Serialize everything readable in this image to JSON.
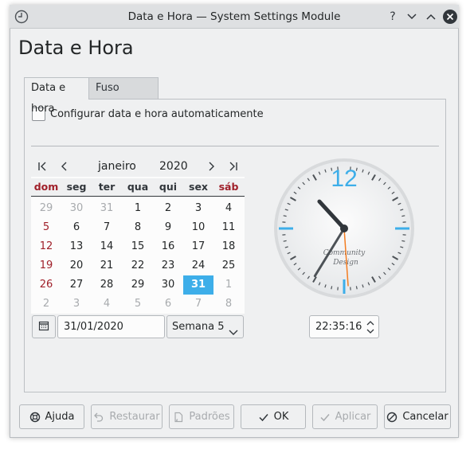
{
  "window": {
    "title": "Data e Hora — System Settings Module",
    "buttons": [
      "help",
      "minimize",
      "maximize",
      "close"
    ]
  },
  "page": {
    "title": "Data e Hora"
  },
  "tabs": [
    {
      "label": "Data e hora",
      "active": true
    },
    {
      "label": "Fuso horário",
      "active": false
    }
  ],
  "auto_config": {
    "label": "Configurar data e hora automaticamente",
    "checked": false
  },
  "calendar": {
    "month": "janeiro",
    "year": "2020",
    "weekdays": [
      "dom",
      "seg",
      "ter",
      "qua",
      "qui",
      "sex",
      "sáb"
    ],
    "weeks": [
      [
        "29",
        "30",
        "31",
        "1",
        "2",
        "3",
        "4"
      ],
      [
        "5",
        "6",
        "7",
        "8",
        "9",
        "10",
        "11"
      ],
      [
        "12",
        "13",
        "14",
        "15",
        "16",
        "17",
        "18"
      ],
      [
        "19",
        "20",
        "21",
        "22",
        "23",
        "24",
        "25"
      ],
      [
        "26",
        "27",
        "28",
        "29",
        "30",
        "31",
        "1"
      ],
      [
        "2",
        "3",
        "4",
        "5",
        "6",
        "7",
        "8"
      ]
    ],
    "selected_day": "31",
    "date_value": "31/01/2020",
    "week_label": "Semana 5"
  },
  "clock": {
    "number": "12",
    "brand_line1": "Community",
    "brand_line2": "Design",
    "time": "22:35:16",
    "hour": 22,
    "minute": 35,
    "second": 16,
    "accent_color": "#3daee9",
    "second_hand_color": "#f47c20"
  },
  "buttons": {
    "help": "Ajuda",
    "reset": "Restaurar",
    "defaults": "Padrões",
    "ok": "OK",
    "apply": "Aplicar",
    "cancel": "Cancelar"
  },
  "colors": {
    "accent": "#3daee9",
    "weekend_red": "#a0202a",
    "window_bg": "#eff0f1"
  }
}
